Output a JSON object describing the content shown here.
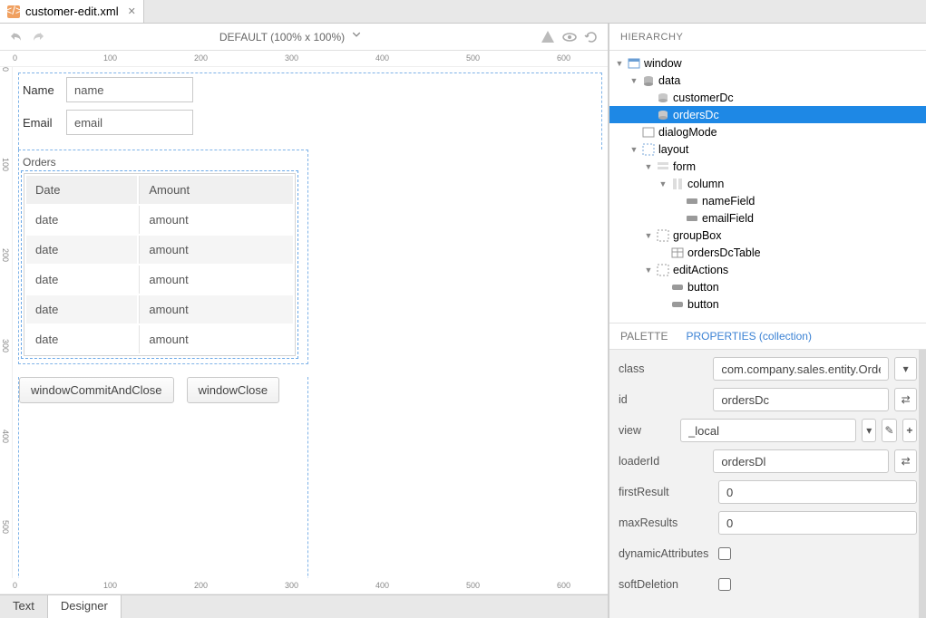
{
  "file_tab": {
    "name": "customer-edit.xml",
    "icon": "xml-icon"
  },
  "toolbar": {
    "zoom_label": "DEFAULT (100% x 100%)"
  },
  "ruler_h": [
    "0",
    "100",
    "200",
    "300",
    "400",
    "500",
    "600"
  ],
  "ruler_v": [
    "0",
    "100",
    "200",
    "300",
    "400",
    "500"
  ],
  "bottom_ruler": [
    "0",
    "100",
    "200",
    "300",
    "400",
    "500",
    "600"
  ],
  "form": {
    "name_label": "Name",
    "name_value": "name",
    "email_label": "Email",
    "email_value": "email",
    "orders_label": "Orders",
    "table": {
      "headers": [
        "Date",
        "Amount"
      ],
      "rows": [
        [
          "date",
          "amount"
        ],
        [
          "date",
          "amount"
        ],
        [
          "date",
          "amount"
        ],
        [
          "date",
          "amount"
        ],
        [
          "date",
          "amount"
        ]
      ]
    },
    "commit_btn": "windowCommitAndClose",
    "close_btn": "windowClose"
  },
  "bottom_tabs": {
    "text": "Text",
    "designer": "Designer"
  },
  "hierarchy_title": "HIERARCHY",
  "tree": [
    {
      "depth": 0,
      "tw": "▼",
      "icon": "window",
      "label": "window"
    },
    {
      "depth": 1,
      "tw": "▼",
      "icon": "data",
      "label": "data"
    },
    {
      "depth": 2,
      "tw": "",
      "icon": "dc",
      "label": "customerDc"
    },
    {
      "depth": 2,
      "tw": "",
      "icon": "dc",
      "label": "ordersDc",
      "selected": true
    },
    {
      "depth": 1,
      "tw": "",
      "icon": "dialog",
      "label": "dialogMode"
    },
    {
      "depth": 1,
      "tw": "▼",
      "icon": "layout",
      "label": "layout"
    },
    {
      "depth": 2,
      "tw": "▼",
      "icon": "form",
      "label": "form"
    },
    {
      "depth": 3,
      "tw": "▼",
      "icon": "column",
      "label": "column"
    },
    {
      "depth": 4,
      "tw": "",
      "icon": "field",
      "label": "nameField"
    },
    {
      "depth": 4,
      "tw": "",
      "icon": "field",
      "label": "emailField"
    },
    {
      "depth": 2,
      "tw": "▼",
      "icon": "group",
      "label": "groupBox"
    },
    {
      "depth": 3,
      "tw": "",
      "icon": "table",
      "label": "ordersDcTable"
    },
    {
      "depth": 2,
      "tw": "▼",
      "icon": "actions",
      "label": "editActions"
    },
    {
      "depth": 3,
      "tw": "",
      "icon": "button",
      "label": "button"
    },
    {
      "depth": 3,
      "tw": "",
      "icon": "button",
      "label": "button"
    }
  ],
  "prop_tabs": {
    "palette": "PALETTE",
    "properties": "PROPERTIES (collection)"
  },
  "properties": {
    "class": {
      "label": "class",
      "value": "com.company.sales.entity.Order"
    },
    "id": {
      "label": "id",
      "value": "ordersDc"
    },
    "view": {
      "label": "view",
      "value": "_local"
    },
    "loaderId": {
      "label": "loaderId",
      "value": "ordersDl"
    },
    "firstResult": {
      "label": "firstResult",
      "value": "0"
    },
    "maxResults": {
      "label": "maxResults",
      "value": "0"
    },
    "dynamicAttributes": {
      "label": "dynamicAttributes",
      "checked": false
    },
    "softDeletion": {
      "label": "softDeletion",
      "checked": false
    }
  }
}
